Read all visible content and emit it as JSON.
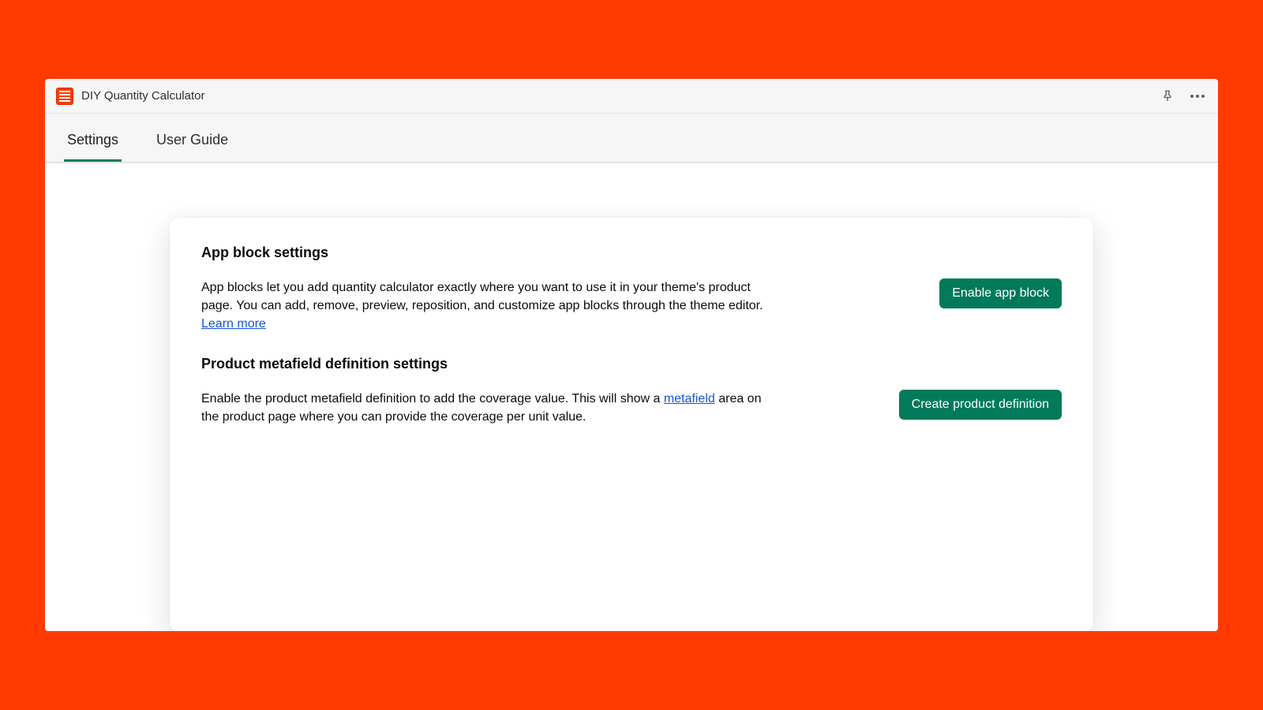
{
  "titlebar": {
    "app_name": "DIY Quantity Calculator"
  },
  "tabs": {
    "settings": "Settings",
    "user_guide": "User Guide"
  },
  "sections": {
    "app_block": {
      "heading": "App block settings",
      "desc_a": "App blocks let you add quantity calculator exactly where you want to use it in your theme's product page. You can add, remove, preview, reposition, and customize app blocks through the theme editor. ",
      "learn_more": "Learn more",
      "button": "Enable app block"
    },
    "metafield": {
      "heading": "Product metafield definition settings",
      "desc_a": "Enable the product metafield definition to add the coverage value. This will show a ",
      "link": "metafield",
      "desc_b": " area on the product page where you can provide the coverage per unit value.",
      "button": "Create product definition"
    }
  }
}
